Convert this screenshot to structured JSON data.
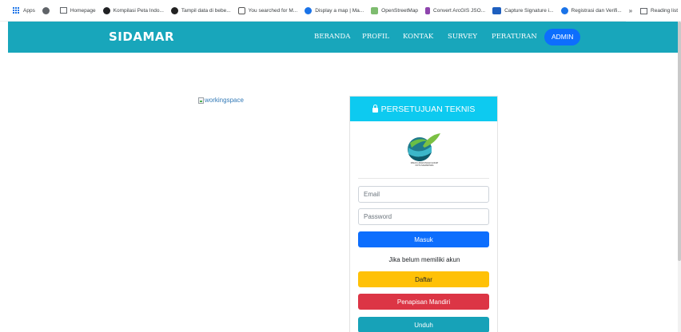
{
  "bookmarks": {
    "apps": "Apps",
    "items": [
      {
        "label": "",
        "icon": "globe-icon"
      },
      {
        "label": "Homepage",
        "icon": "list-icon"
      },
      {
        "label": "Kompilasi Peta Indo...",
        "icon": "site-icon"
      },
      {
        "label": "Tampil data di bebe...",
        "icon": "site-icon"
      },
      {
        "label": "You searched for M...",
        "icon": "site-icon"
      },
      {
        "label": "Display a map | Ma...",
        "icon": "site-icon"
      },
      {
        "label": "OpenStreetMap",
        "icon": "site-icon"
      },
      {
        "label": "Convert ArcGIS JSO...",
        "icon": "site-icon"
      },
      {
        "label": "Capture Signature i...",
        "icon": "site-icon"
      },
      {
        "label": "Registrasi dan Verifi...",
        "icon": "site-icon"
      }
    ],
    "overflow": "»",
    "reading_list": "Reading list"
  },
  "navbar": {
    "brand": "SIDAMAR",
    "links": [
      "BERANDA",
      "PROFIL",
      "KONTAK",
      "SURVEY",
      "PERATURAN"
    ],
    "admin": "ADMIN"
  },
  "image_alt": "workingspace",
  "card": {
    "title": "PERSETUJUAN TEKNIS",
    "logo_text_1": "DINAS LINGKUNGAN HIDUP",
    "logo_text_2": "KOTA SAMARINDA",
    "email_placeholder": "Email",
    "password_placeholder": "Password",
    "login_button": "Masuk",
    "no_account_text": "Jika belum memiliki akun",
    "register_button": "Daftar",
    "screening_button": "Penapisan Mandiri",
    "download_button": "Unduh"
  },
  "colors": {
    "navbar": "#18a6bb",
    "card_header": "#0dcaf0",
    "primary": "#0d6efd",
    "warning": "#ffc107",
    "danger": "#dc3545",
    "info": "#17a2b8"
  }
}
